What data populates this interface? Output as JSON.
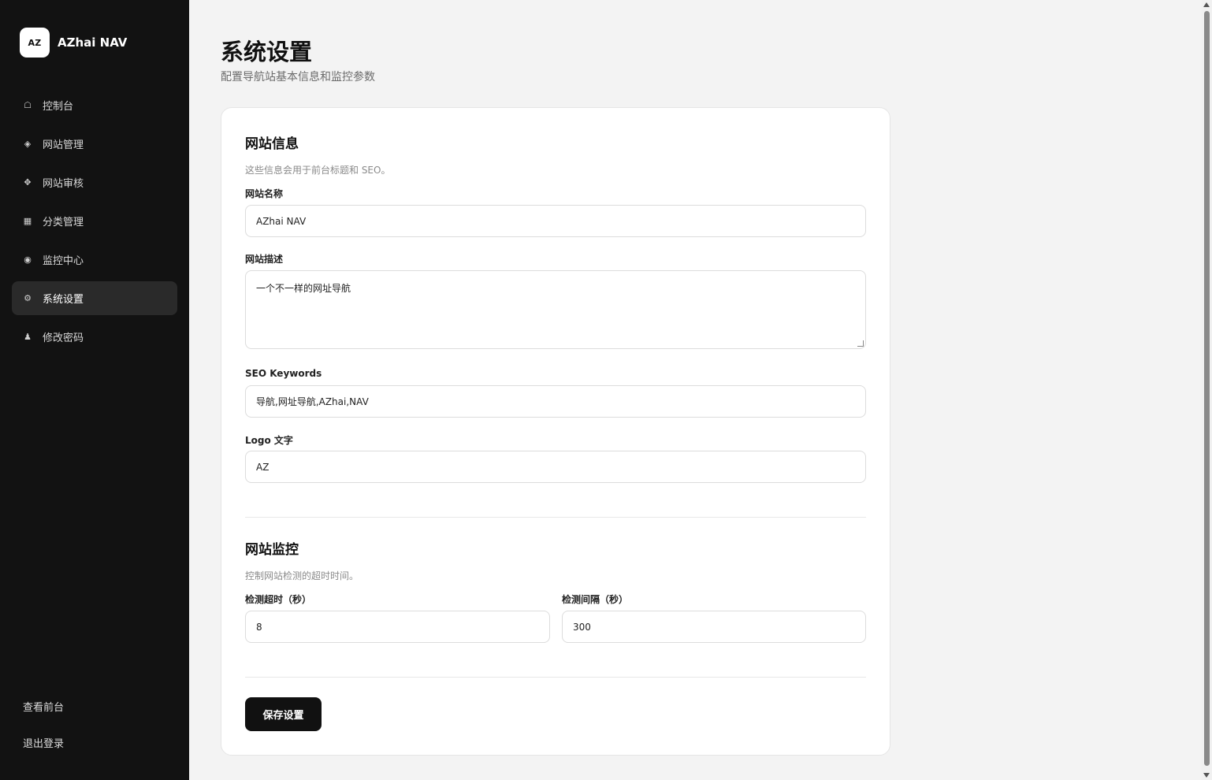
{
  "brand": {
    "logo_text": "AZ",
    "name": "AZhai NAV"
  },
  "sidebar": {
    "items": [
      {
        "icon": "home-icon",
        "glyph": "☖",
        "label": "控制台"
      },
      {
        "icon": "diamond-icon",
        "glyph": "◈",
        "label": "网站管理"
      },
      {
        "icon": "review-icon",
        "glyph": "✥",
        "label": "网站审核"
      },
      {
        "icon": "grid-icon",
        "glyph": "▦",
        "label": "分类管理"
      },
      {
        "icon": "radio-icon",
        "glyph": "◉",
        "label": "监控中心"
      },
      {
        "icon": "gear-icon",
        "glyph": "⚙",
        "label": "系统设置"
      },
      {
        "icon": "user-icon",
        "glyph": "♟",
        "label": "修改密码"
      }
    ],
    "active_index": 5,
    "bottom": {
      "view_frontend": "查看前台",
      "logout": "退出登录"
    }
  },
  "page": {
    "title": "系统设置",
    "subtitle": "配置导航站基本信息和监控参数"
  },
  "site_info": {
    "title": "网站信息",
    "description": "这些信息会用于前台标题和 SEO。",
    "name_label": "网站名称",
    "name_value": "AZhai NAV",
    "desc_label": "网站描述",
    "desc_value": "一个不一样的网址导航",
    "keywords_label": "SEO Keywords",
    "keywords_value": "导航,网址导航,AZhai,NAV",
    "logo_label": "Logo 文字",
    "logo_value": "AZ"
  },
  "monitor": {
    "title": "网站监控",
    "description": "控制网站检测的超时时间。",
    "timeout_label": "检测超时（秒）",
    "timeout_value": "8",
    "interval_label": "检测间隔（秒）",
    "interval_value": "300"
  },
  "actions": {
    "save_label": "保存设置"
  }
}
